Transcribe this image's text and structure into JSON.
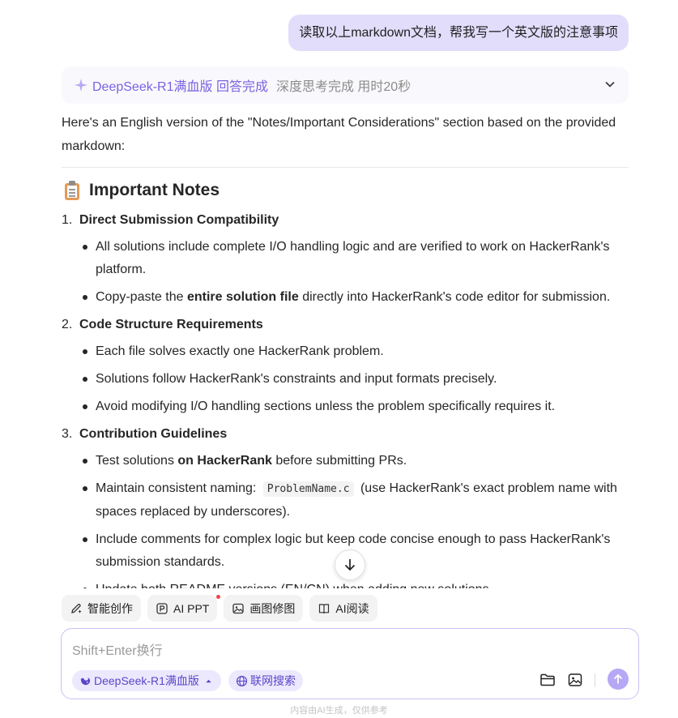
{
  "user_message": "读取以上markdown文档，帮我写一个英文版的注意事项",
  "thinking": {
    "title": "DeepSeek-R1满血版 回答完成",
    "meta": "深度思考完成 用时20秒"
  },
  "answer": {
    "intro": "Here's an English version of the \"Notes/Important Considerations\" section based on the provided markdown:",
    "heading": "Important Notes",
    "sections": [
      {
        "num": "1.",
        "title": "Direct Submission Compatibility",
        "bullets": [
          {
            "a": "All solutions include complete I/O handling logic and are verified to work on HackerRank's platform."
          },
          {
            "a": "Copy-paste the ",
            "b": "entire solution file",
            "c": " directly into HackerRank's code editor for submission."
          }
        ]
      },
      {
        "num": "2.",
        "title": "Code Structure Requirements",
        "bullets": [
          {
            "a": "Each file solves exactly one HackerRank problem."
          },
          {
            "a": "Solutions follow HackerRank's constraints and input formats precisely."
          },
          {
            "a": "Avoid modifying I/O handling sections unless the problem specifically requires it."
          }
        ]
      },
      {
        "num": "3.",
        "title": "Contribution Guidelines",
        "bullets": [
          {
            "a": "Test solutions ",
            "b": "on HackerRank",
            "c": " before submitting PRs."
          },
          {
            "a": "Maintain consistent naming: ",
            "code": "ProblemName.c",
            "c": " (use HackerRank's exact problem name with spaces replaced by underscores)."
          },
          {
            "a": "Include comments for complex logic but keep code concise enough to pass HackerRank's submission standards."
          },
          {
            "a": "Update both README versions (EN/CN) when adding new solutions."
          }
        ]
      }
    ]
  },
  "tools": [
    {
      "label": "智能创作",
      "icon": "pen-sparkle-icon"
    },
    {
      "label": "AI PPT",
      "icon": "ppt-icon",
      "badge": true
    },
    {
      "label": "画图修图",
      "icon": "image-edit-icon"
    },
    {
      "label": "AI阅读",
      "icon": "book-icon"
    }
  ],
  "composer": {
    "placeholder": "Shift+Enter换行",
    "model_pill": "DeepSeek-R1满血版",
    "search_pill": "联网搜索"
  },
  "footer": "内容由AI生成，仅供参考",
  "colors": {
    "accent": "#7b62e2",
    "user_bubble": "#e2ddfb"
  }
}
